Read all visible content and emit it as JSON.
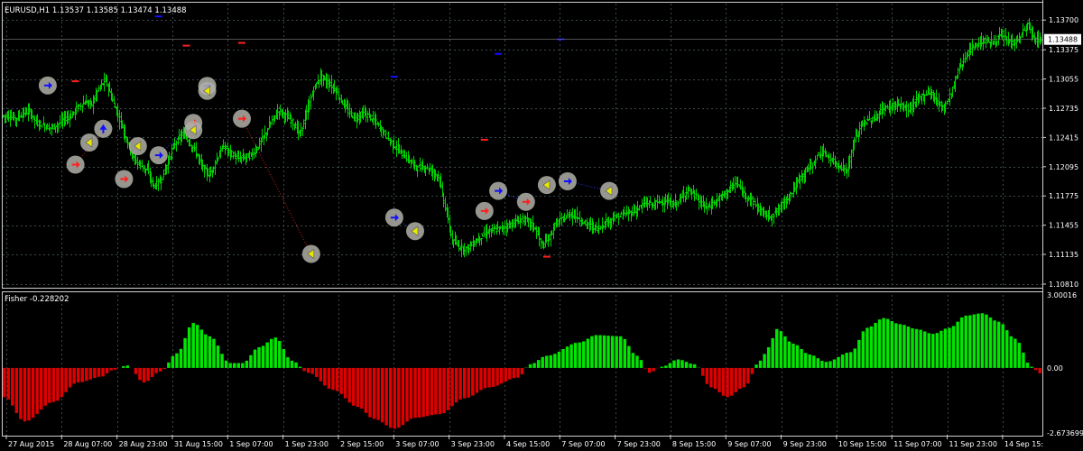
{
  "window": {
    "main_title": "EURUSD,H1  1.13537 1.13585 1.13474 1.13488",
    "sub_title": "Fisher -0.228202"
  },
  "colors": {
    "background": "#000000",
    "grid": "#3a4a4a",
    "candle": "#00d000",
    "fisher_positive": "#00e600",
    "fisher_negative": "#e00000",
    "marker_blue": "#1010ff",
    "marker_red": "#ff2020",
    "marker_yellow": "#e8e800",
    "marker_halo": "#b0b0a8",
    "link_blue": "#3030ff",
    "link_red": "#d02020",
    "price_label_bg": "#ffffff"
  },
  "chart_data": [
    {
      "type": "line",
      "name": "EURUSD,H1",
      "ohlc_header": "1.13537 1.13585 1.13474 1.13488",
      "current_price": "1.13488",
      "ylim": [
        1.1078,
        1.1388
      ],
      "yticks": [
        "1.13700",
        "1.13375",
        "1.13055",
        "1.12735",
        "1.12415",
        "1.12095",
        "1.11775",
        "1.11455",
        "1.11135",
        "1.10810"
      ],
      "ytick_values": [
        1.137,
        1.13375,
        1.13055,
        1.12735,
        1.12415,
        1.12095,
        1.11775,
        1.11455,
        1.11135,
        1.1081
      ],
      "close_series": [
        1.1265,
        1.1262,
        1.1268,
        1.127,
        1.1258,
        1.1255,
        1.1252,
        1.1255,
        1.1262,
        1.1265,
        1.1275,
        1.128,
        1.1278,
        1.1295,
        1.1305,
        1.1282,
        1.1262,
        1.124,
        1.1218,
        1.1212,
        1.1205,
        1.1188,
        1.1195,
        1.1215,
        1.1235,
        1.1245,
        1.1238,
        1.1225,
        1.1208,
        1.12,
        1.1218,
        1.1232,
        1.1225,
        1.1218,
        1.122,
        1.1222,
        1.1232,
        1.1245,
        1.126,
        1.1272,
        1.1265,
        1.1258,
        1.1245,
        1.1268,
        1.1295,
        1.1308,
        1.1302,
        1.1295,
        1.1282,
        1.127,
        1.1262,
        1.1268,
        1.1265,
        1.1258,
        1.1248,
        1.1238,
        1.123,
        1.1222,
        1.1215,
        1.1208,
        1.121,
        1.1205,
        1.12,
        1.1165,
        1.1128,
        1.1122,
        1.112,
        1.1125,
        1.1132,
        1.1138,
        1.114,
        1.1142,
        1.1145,
        1.1148,
        1.1152,
        1.115,
        1.1142,
        1.1122,
        1.1132,
        1.1148,
        1.1152,
        1.1158,
        1.1155,
        1.1148,
        1.1145,
        1.1142,
        1.1148,
        1.1152,
        1.1155,
        1.1158,
        1.116,
        1.1165,
        1.117,
        1.1168,
        1.1172,
        1.117,
        1.1168,
        1.1175,
        1.1185,
        1.1178,
        1.1168,
        1.1165,
        1.1172,
        1.1178,
        1.1185,
        1.1192,
        1.118,
        1.1175,
        1.1165,
        1.1158,
        1.1155,
        1.1162,
        1.1172,
        1.1182,
        1.1195,
        1.1205,
        1.1212,
        1.1225,
        1.1222,
        1.1215,
        1.121,
        1.1205,
        1.1238,
        1.1255,
        1.126,
        1.1262,
        1.1272,
        1.1275,
        1.1278,
        1.1275,
        1.1272,
        1.1282,
        1.1288,
        1.1292,
        1.128,
        1.1275,
        1.129,
        1.1315,
        1.133,
        1.134,
        1.1345,
        1.1348,
        1.1345,
        1.1352,
        1.1348,
        1.1345,
        1.1352,
        1.1365,
        1.1348,
        1.1349
      ],
      "markers": [
        {
          "idx": 6,
          "price": 1.12985,
          "icon": "arrow-right-blue"
        },
        {
          "idx": 10,
          "price": 1.12118,
          "icon": "arrow-right-red"
        },
        {
          "idx": 12,
          "price": 1.1236,
          "icon": "arrow-left-yellow"
        },
        {
          "idx": 14,
          "price": 1.1251,
          "icon": "arrow-up-blue"
        },
        {
          "idx": 17,
          "price": 1.1196,
          "icon": "arrow-right-red"
        },
        {
          "idx": 19,
          "price": 1.1232,
          "icon": "arrow-left-yellow"
        },
        {
          "idx": 22,
          "price": 1.1222,
          "icon": "arrow-right-blue"
        },
        {
          "idx": 27,
          "price": 1.12575,
          "icon": "arrow-right-red"
        },
        {
          "idx": 27,
          "price": 1.12495,
          "icon": "arrow-left-yellow"
        },
        {
          "idx": 29,
          "price": 1.1298,
          "icon": "arrow-right-blue"
        },
        {
          "idx": 29,
          "price": 1.12925,
          "icon": "arrow-left-yellow"
        },
        {
          "idx": 34,
          "price": 1.1262,
          "icon": "arrow-right-red"
        },
        {
          "idx": 44,
          "price": 1.1114,
          "icon": "arrow-left-yellow"
        },
        {
          "idx": 56,
          "price": 1.11538,
          "icon": "arrow-right-blue"
        },
        {
          "idx": 59,
          "price": 1.1139,
          "icon": "arrow-left-yellow"
        },
        {
          "idx": 69,
          "price": 1.1161,
          "icon": "arrow-right-red"
        },
        {
          "idx": 71,
          "price": 1.1183,
          "icon": "arrow-right-blue"
        },
        {
          "idx": 75,
          "price": 1.1171,
          "icon": "arrow-right-red"
        },
        {
          "idx": 78,
          "price": 1.11895,
          "icon": "arrow-left-yellow"
        },
        {
          "idx": 81,
          "price": 1.11935,
          "icon": "arrow-right-blue"
        },
        {
          "idx": 87,
          "price": 1.1183,
          "icon": "arrow-left-yellow"
        }
      ],
      "links": [
        {
          "from": 10,
          "to": 14,
          "color": "red"
        },
        {
          "from": 22,
          "to": 27,
          "color": "blue"
        },
        {
          "from": 34,
          "to": 44,
          "color": "red"
        },
        {
          "from": 56,
          "to": 59,
          "color": "blue"
        },
        {
          "from": 71,
          "to": 75,
          "color": "blue"
        },
        {
          "from": 81,
          "to": 87,
          "color": "blue"
        }
      ],
      "dashes": [
        {
          "idx": 10,
          "price": 1.1303,
          "color": "red"
        },
        {
          "idx": 22,
          "price": 1.1374,
          "color": "blue"
        },
        {
          "idx": 26,
          "price": 1.1342,
          "color": "red"
        },
        {
          "idx": 34,
          "price": 1.1345,
          "color": "red"
        },
        {
          "idx": 56,
          "price": 1.1308,
          "color": "blue"
        },
        {
          "idx": 69,
          "price": 1.1239,
          "color": "red"
        },
        {
          "idx": 71,
          "price": 1.1333,
          "color": "blue"
        },
        {
          "idx": 78,
          "price": 1.1111,
          "color": "red"
        },
        {
          "idx": 80,
          "price": 1.1349,
          "color": "blue"
        }
      ]
    },
    {
      "type": "bar",
      "name": "Fisher",
      "title": "Fisher -0.228202",
      "ylim": [
        -2.67369,
        3.00016
      ],
      "yticks": [
        "3.00016",
        "0.00",
        "-2.673699"
      ],
      "ytick_values": [
        3.00016,
        0,
        -2.673699
      ],
      "x": [
        "27 Aug 2015",
        "28 Aug 07:00",
        "28 Aug 23:00",
        "31 Aug 15:00",
        "1 Sep 07:00",
        "1 Sep 23:00",
        "2 Sep 15:00",
        "3 Sep 07:00",
        "3 Sep 23:00",
        "4 Sep 15:00",
        "7 Sep 07:00",
        "7 Sep 23:00",
        "8 Sep 15:00",
        "9 Sep 07:00",
        "9 Sep 23:00",
        "10 Sep 15:00",
        "11 Sep 07:00",
        "11 Sep 23:00",
        "14 Sep 15:"
      ],
      "anchors": [
        [
          0,
          -1.2
        ],
        [
          5,
          -2.2
        ],
        [
          12,
          -1.4
        ],
        [
          18,
          -0.6
        ],
        [
          24,
          -0.35
        ],
        [
          26,
          -0.1
        ],
        [
          30,
          0.1
        ],
        [
          34,
          -0.6
        ],
        [
          38,
          -0.15
        ],
        [
          42,
          0.6
        ],
        [
          46,
          1.85
        ],
        [
          50,
          1.3
        ],
        [
          55,
          0.2
        ],
        [
          58,
          0.2
        ],
        [
          62,
          0.85
        ],
        [
          66,
          1.25
        ],
        [
          70,
          0.3
        ],
        [
          74,
          -0.2
        ],
        [
          80,
          -0.9
        ],
        [
          86,
          -1.6
        ],
        [
          90,
          -2.1
        ],
        [
          95,
          -2.5
        ],
        [
          100,
          -2.05
        ],
        [
          106,
          -1.9
        ],
        [
          112,
          -1.25
        ],
        [
          118,
          -0.8
        ],
        [
          125,
          -0.4
        ],
        [
          128,
          0.15
        ],
        [
          132,
          0.5
        ],
        [
          140,
          1.05
        ],
        [
          144,
          1.35
        ],
        [
          150,
          1.3
        ],
        [
          154,
          0.5
        ],
        [
          157,
          -0.2
        ],
        [
          160,
          0.05
        ],
        [
          164,
          0.35
        ],
        [
          168,
          0.15
        ],
        [
          172,
          -0.8
        ],
        [
          176,
          -1.2
        ],
        [
          180,
          -0.8
        ],
        [
          184,
          0.3
        ],
        [
          186,
          0.85
        ],
        [
          188,
          1.6
        ],
        [
          192,
          1.0
        ],
        [
          196,
          0.55
        ],
        [
          200,
          0.25
        ],
        [
          206,
          0.65
        ],
        [
          210,
          1.65
        ],
        [
          214,
          2.05
        ],
        [
          218,
          1.8
        ],
        [
          222,
          1.6
        ],
        [
          226,
          1.4
        ],
        [
          230,
          1.65
        ],
        [
          234,
          2.15
        ],
        [
          238,
          2.25
        ],
        [
          242,
          1.9
        ],
        [
          246,
          1.2
        ],
        [
          250,
          0.05
        ],
        [
          252,
          -0.22
        ]
      ],
      "nbars": 253
    }
  ]
}
